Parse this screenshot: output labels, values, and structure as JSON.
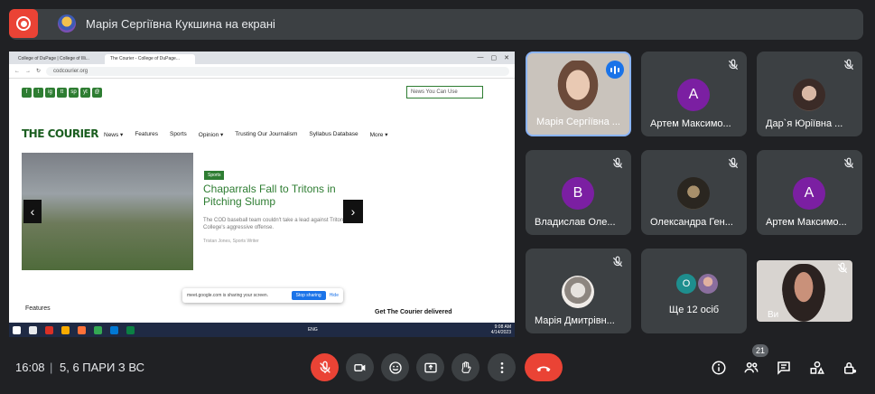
{
  "top": {
    "presenting_text": "Марія Сергіївна Кукшина на екрані"
  },
  "shared_screen": {
    "tabs": [
      "College of DuPage | College of Illi...",
      "The Courier - College of DuPage..."
    ],
    "url": "codcourier.org",
    "site": {
      "social_icons": [
        "f",
        "t",
        "ig",
        "tt",
        "sp",
        "yt",
        "@"
      ],
      "search_placeholder": "News You Can Use",
      "logo": "THE COURIER",
      "nav": [
        "News ▾",
        "Features",
        "Sports",
        "Opinion ▾",
        "Trusting Our Journalism",
        "Syllabus Database",
        "More ▾"
      ],
      "hero_tag": "Sports",
      "hero_title": "Chaparrals Fall to Tritons in Pitching Slump",
      "hero_desc": "The COD baseball team couldn't take a lead against Triton College's aggressive offense.",
      "hero_byline": "Tristan Jones, Sports Writer",
      "section_label": "Features",
      "promo_text": "Get The Courier delivered",
      "share_text": "meet.google.com is sharing your screen.",
      "stop_sharing": "Stop sharing",
      "hide": "Hide"
    },
    "taskbar": {
      "time": "9:08 AM",
      "date": "4/14/2023",
      "lang": "ENG"
    }
  },
  "participants": [
    {
      "name": "Марія Сергіївна ...",
      "type": "video",
      "speaking": true
    },
    {
      "name": "Артем Максимо...",
      "type": "letter",
      "letter": "А",
      "color": "#7b1fa2"
    },
    {
      "name": "Дар`я Юріївна ...",
      "type": "photo"
    },
    {
      "name": "Владислав Оле...",
      "type": "letter",
      "letter": "В",
      "color": "#7b1fa2"
    },
    {
      "name": "Олександра Ген...",
      "type": "photo"
    },
    {
      "name": "Артем Максимо...",
      "type": "letter",
      "letter": "А",
      "color": "#7b1fa2"
    },
    {
      "name": "Марія Дмитрівн...",
      "type": "photo"
    },
    {
      "name": "Ще 12 осіб",
      "type": "more",
      "letter": "О"
    },
    {
      "name": "Ви",
      "type": "video-self"
    }
  ],
  "bottom": {
    "time": "16:08",
    "separator": "|",
    "meeting_title": "5, 6 ПАРИ З ВС",
    "participants_count": "21"
  }
}
